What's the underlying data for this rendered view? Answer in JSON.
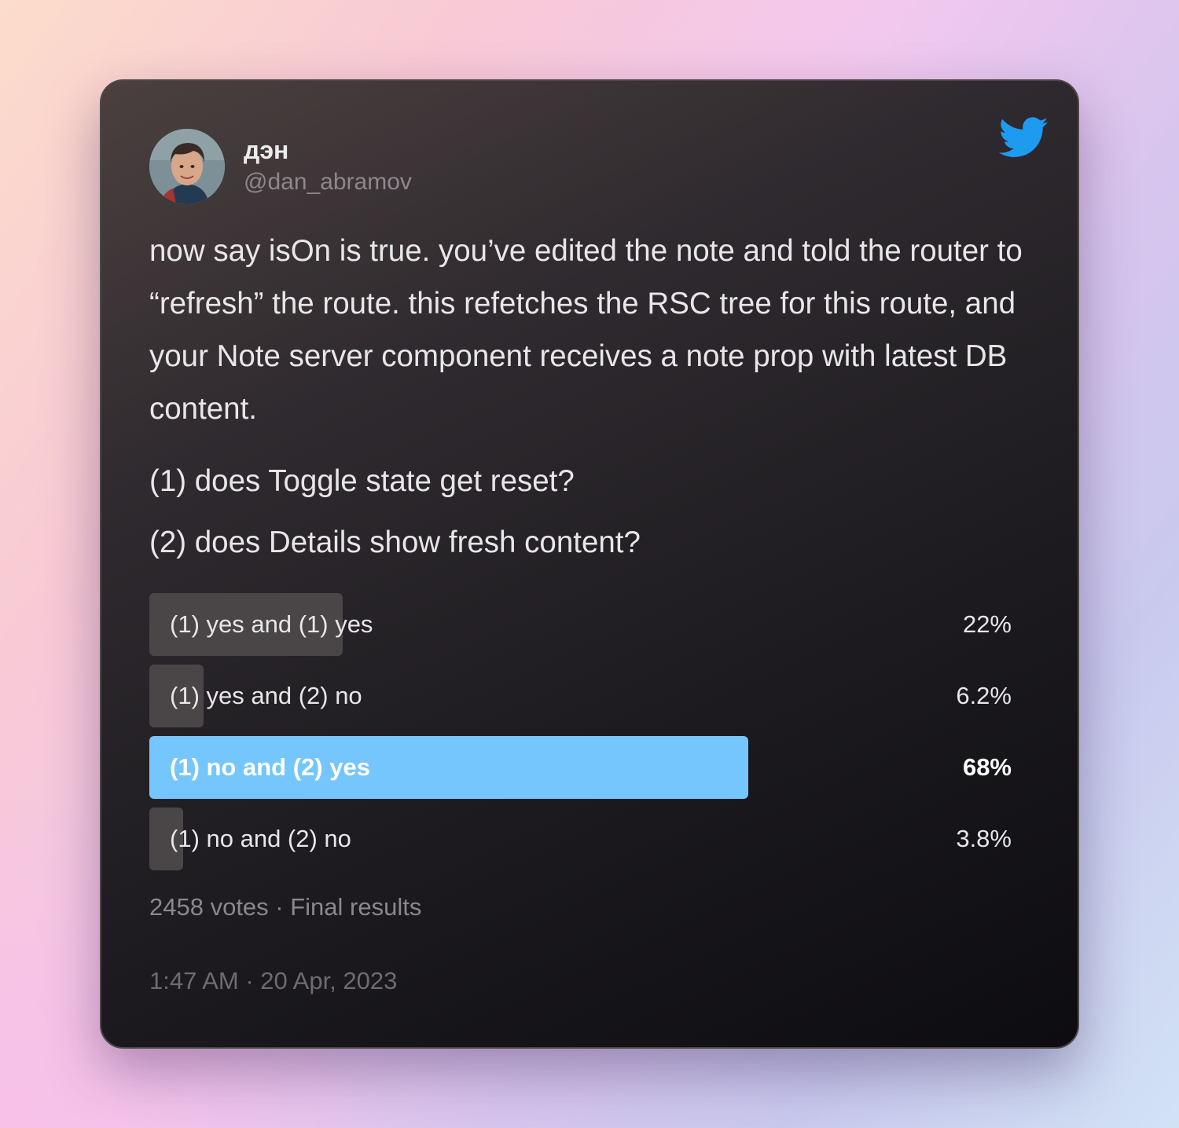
{
  "author": {
    "display_name": "дэн",
    "handle": "@dan_abramov",
    "avatar": "avatar-photo"
  },
  "brand_icon": "twitter-bird-icon",
  "tweet": {
    "text": "now say isOn is true. you’ve edited the note and told the router to “refresh” the route. this refetches the RSC tree for this route, and your Note server component receives a note prop with latest DB content.",
    "questions": [
      "(1) does Toggle state get reset?",
      "(2) does Details show fresh content?"
    ]
  },
  "poll": {
    "options": [
      {
        "label": "(1) yes and (1) yes",
        "percent_text": "22%",
        "percent": 22,
        "winner": false
      },
      {
        "label": "(1) yes and (2) no",
        "percent_text": "6.2%",
        "percent": 6.2,
        "winner": false
      },
      {
        "label": "(1) no and (2) yes",
        "percent_text": "68%",
        "percent": 68,
        "winner": true
      },
      {
        "label": "(1) no and (2) no",
        "percent_text": "3.8%",
        "percent": 3.8,
        "winner": false
      }
    ],
    "summary": "2458 votes · Final results"
  },
  "timestamp": "1:47 AM · 20 Apr, 2023",
  "colors": {
    "accent": "#1d9bf0",
    "winner_bar": "#75c6fc",
    "bar": "#4a4547"
  }
}
